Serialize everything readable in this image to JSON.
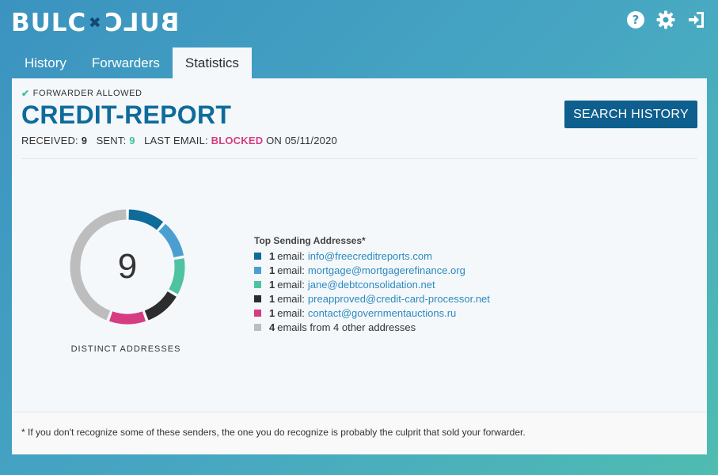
{
  "app": {
    "logo_left": "BULC",
    "logo_mark": "✖",
    "logo_right": "BULC"
  },
  "tabs": [
    {
      "label": "History",
      "active": false
    },
    {
      "label": "Forwarders",
      "active": false
    },
    {
      "label": "Statistics",
      "active": true
    }
  ],
  "forwarder": {
    "status": "FORWARDER ALLOWED",
    "name": "CREDIT-REPORT",
    "received_label": "RECEIVED:",
    "received": "9",
    "sent_label": "SENT:",
    "sent": "9",
    "last_email_label": "LAST EMAIL:",
    "last_email_status": "BLOCKED",
    "on_label": "ON",
    "last_email_date": "05/11/2020",
    "search_button": "SEARCH HISTORY"
  },
  "chart_data": {
    "type": "pie",
    "center_value": "9",
    "caption": "DISTINCT ADDRESSES",
    "legend_title": "Top Sending Addresses*",
    "email_word": "email:",
    "slices": [
      {
        "count": 1,
        "address": "info@freecreditreports.com",
        "color": "#0f6b9a"
      },
      {
        "count": 1,
        "address": "mortgage@mortgagerefinance.org",
        "color": "#4a9fd0"
      },
      {
        "count": 1,
        "address": "jane@debtconsolidation.net",
        "color": "#4fc3a1"
      },
      {
        "count": 1,
        "address": "preapproved@credit-card-processor.net",
        "color": "#2d2d2d"
      },
      {
        "count": 1,
        "address": "contact@governmentauctions.ru",
        "color": "#d63c80"
      },
      {
        "count": 4,
        "text": "emails from 4 other addresses",
        "color": "#bdbdbd"
      }
    ]
  },
  "footer": {
    "note": "* If you don't recognize some of these senders, the one you do recognize is probably the culprit that sold your forwarder."
  }
}
